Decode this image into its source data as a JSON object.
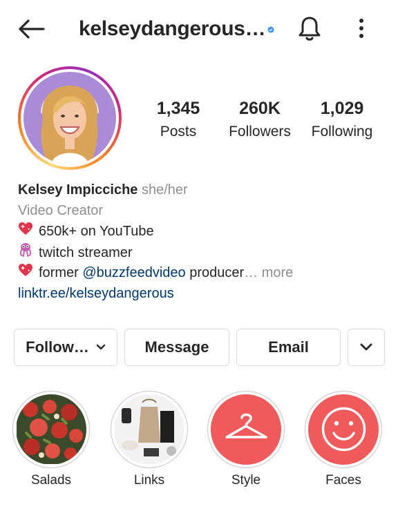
{
  "header": {
    "username": "kelseydangerous…",
    "back_icon": "arrow-left-icon",
    "bell_icon": "bell-icon",
    "more_icon": "more-vertical-icon",
    "verified_color": "#3897f0"
  },
  "stats": {
    "posts": {
      "value": "1,345",
      "label": "Posts"
    },
    "followers": {
      "value": "260K",
      "label": "Followers"
    },
    "following": {
      "value": "1,029",
      "label": "Following"
    }
  },
  "bio": {
    "name": "Kelsey Impicciche",
    "pronouns": "she/her",
    "category": "Video Creator",
    "line1": "650k+ on YouTube",
    "line2": "twitch streamer",
    "line3_prefix": "former ",
    "line3_mention": "@buzzfeedvideo",
    "line3_suffix": " producer",
    "line3_ellipsis": "…",
    "more": " more",
    "link": "linktr.ee/kelseydangerous",
    "link_color": "#00376b"
  },
  "buttons": {
    "follow": "Follow…",
    "message": "Message",
    "email": "Email"
  },
  "highlights": [
    {
      "label": "Salads"
    },
    {
      "label": "Links"
    },
    {
      "label": "Style",
      "icon": "hanger-icon",
      "bg": "#f05a5b"
    },
    {
      "label": "Faces",
      "icon": "smiley-face-icon",
      "bg": "#f05a5b"
    }
  ],
  "colors": {
    "text": "#262626",
    "secondary": "#8e8e8e",
    "border": "#dbdbdb"
  }
}
